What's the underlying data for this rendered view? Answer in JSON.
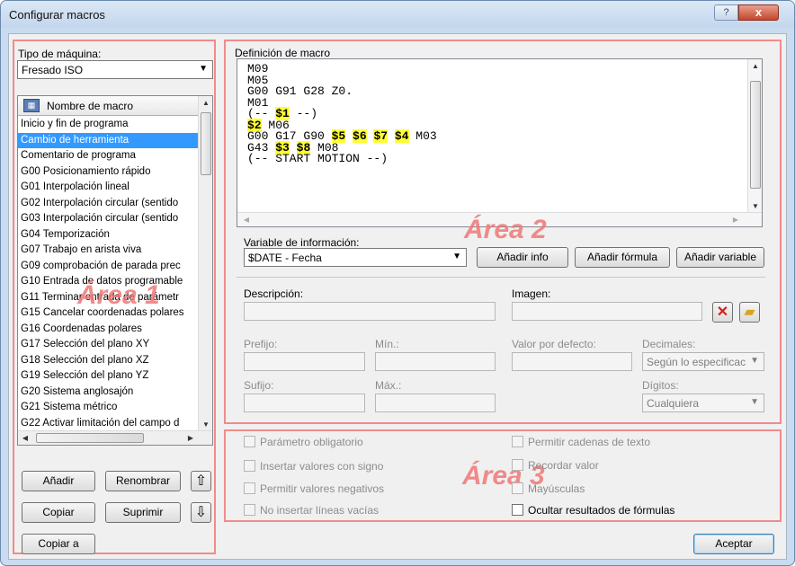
{
  "window": {
    "title": "Configurar macros",
    "help": "?",
    "close": "x"
  },
  "area_labels": {
    "area1": "Área 1",
    "area2": "Área 2",
    "area3": "Área 3"
  },
  "machine": {
    "label": "Tipo de máquina:",
    "value": "Fresado ISO"
  },
  "macro_list": {
    "header": "Nombre de macro",
    "items": [
      "Inicio y fin de programa",
      "Cambio de herramienta",
      "Comentario de programa",
      "G00 Posicionamiento rápido",
      "G01 Interpolación lineal",
      "G02 Interpolación circular (sentido",
      "G03 Interpolación circular (sentido",
      "G04 Temporización",
      "G07 Trabajo en arista viva",
      "G09 comprobación de parada prec",
      "G10 Entrada de datos programable",
      "G11 Terminar entrada de parámetr",
      "G15 Cancelar coordenadas polares",
      "G16 Coordenadas polares",
      "G17 Selección del plano XY",
      "G18 Selección del plano XZ",
      "G19 Selección del plano YZ",
      "G20 Sistema anglosajón",
      "G21 Sistema métrico",
      "G22 Activar limitación del campo d"
    ],
    "selected_index": 1
  },
  "left_buttons": {
    "add": "Añadir",
    "rename": "Renombrar",
    "copy": "Copiar",
    "delete": "Suprimir",
    "copy_to": "Copiar a"
  },
  "definition": {
    "label": "Definición de macro",
    "lines": [
      [
        {
          "t": "M09"
        }
      ],
      [
        {
          "t": "M05"
        }
      ],
      [
        {
          "t": "G00 G91 G28 Z0."
        }
      ],
      [
        {
          "t": "M01"
        }
      ],
      [
        {
          "t": "(-- "
        },
        {
          "t": "$1",
          "h": true
        },
        {
          "t": " --)"
        }
      ],
      [
        {
          "t": "$2",
          "h": true
        },
        {
          "t": " M06"
        }
      ],
      [
        {
          "t": "G00 G17 G90 "
        },
        {
          "t": "$5",
          "h": true
        },
        {
          "t": " "
        },
        {
          "t": "$6",
          "h": true
        },
        {
          "t": " "
        },
        {
          "t": "$7",
          "h": true
        },
        {
          "t": " "
        },
        {
          "t": "$4",
          "h": true
        },
        {
          "t": " M03"
        }
      ],
      [
        {
          "t": "G43 "
        },
        {
          "t": "$3",
          "h": true
        },
        {
          "t": " "
        },
        {
          "t": "$8",
          "h": true
        },
        {
          "t": " M08"
        }
      ],
      [
        {
          "t": "(-- START MOTION --)"
        }
      ]
    ]
  },
  "info_variable": {
    "label": "Variable de información:",
    "value": "$DATE - Fecha"
  },
  "action_buttons": {
    "add_info": "Añadir info",
    "add_formula": "Añadir fórmula",
    "add_variable": "Añadir variable"
  },
  "fields": {
    "description": "Descripción:",
    "image": "Imagen:",
    "prefix": "Prefijo:",
    "min": "Mín.:",
    "default": "Valor por defecto:",
    "decimals": "Decimales:",
    "decimals_value": "Según lo especificac",
    "suffix": "Sufijo:",
    "max": "Máx.:",
    "digits": "Dígitos:",
    "digits_value": "Cualquiera"
  },
  "options": {
    "mandatory": "Parámetro obligatorio",
    "signed": "Insertar valores con signo",
    "negative": "Permitir valores negativos",
    "no_empty": "No insertar líneas vacías",
    "strings": "Permitir cadenas de texto",
    "remember": "Recordar valor",
    "uppercase": "Mayúsculas",
    "hide_formula": "Ocultar resultados de fórmulas"
  },
  "accept": "Aceptar"
}
